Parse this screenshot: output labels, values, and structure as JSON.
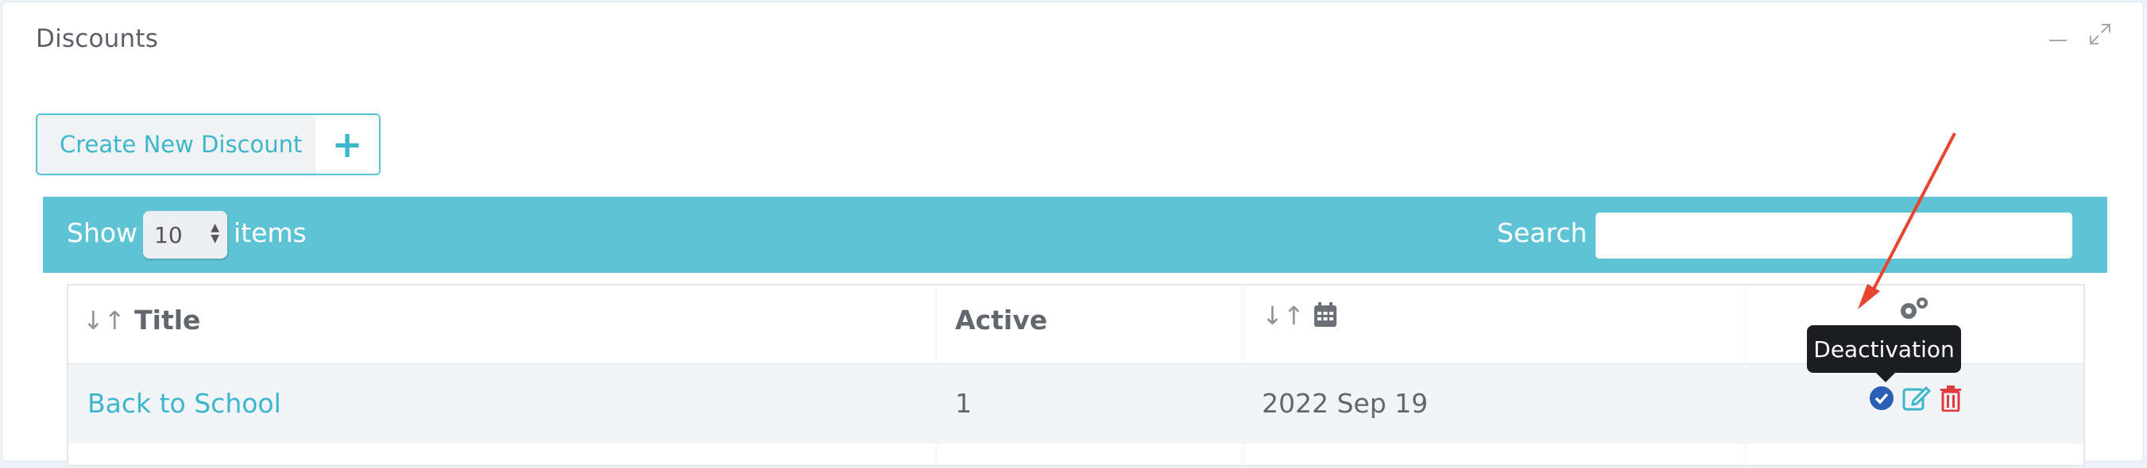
{
  "panel": {
    "title": "Discounts",
    "minimize_icon": "minimize-icon",
    "maximize_icon": "expand-icon"
  },
  "create_button": {
    "label": "Create New Discount",
    "plus": "+"
  },
  "toolbar": {
    "show_label": "Show",
    "page_size": "10",
    "items_label": "items",
    "search_label": "Search",
    "search_value": ""
  },
  "table": {
    "columns": [
      {
        "label": "Title",
        "sortable": true
      },
      {
        "label": "Active",
        "sortable": false
      },
      {
        "label": "",
        "sortable": true,
        "icon": "calendar-icon"
      },
      {
        "label": "",
        "sortable": false,
        "icon": "gears-icon"
      }
    ],
    "rows": [
      {
        "title": "Back to School",
        "active": "1",
        "date": "2022 Sep 19"
      }
    ]
  },
  "tooltip": {
    "text": "Deactivation"
  },
  "colors": {
    "accent": "#5fc3d6",
    "link": "#3cb6cb",
    "annotation_arrow": "#e8432f",
    "deactivate": "#2a5fb5",
    "delete": "#e0393e"
  }
}
